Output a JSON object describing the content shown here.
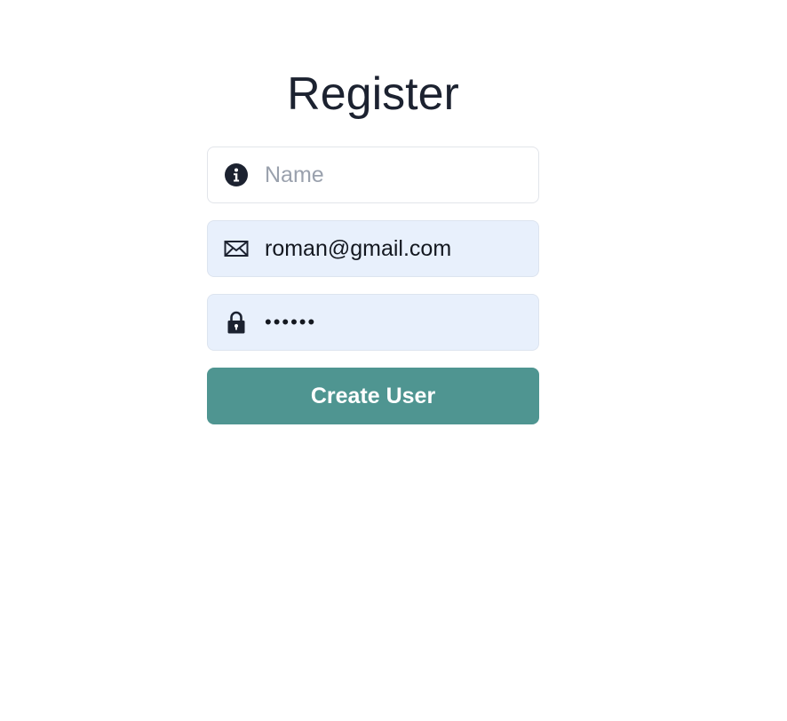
{
  "form": {
    "title": "Register",
    "name_field": {
      "value": "",
      "placeholder": "Name",
      "icon": "info-icon"
    },
    "email_field": {
      "value": "roman@gmail.com",
      "placeholder": "",
      "icon": "envelope-icon"
    },
    "password_field": {
      "value": "••••••",
      "placeholder": "",
      "icon": "lock-icon"
    },
    "submit_label": "Create User"
  },
  "colors": {
    "accent": "#4f9591",
    "autofill_background": "#e8f0fc",
    "title_text": "#1c2230",
    "placeholder_text": "#9aa1ad"
  }
}
